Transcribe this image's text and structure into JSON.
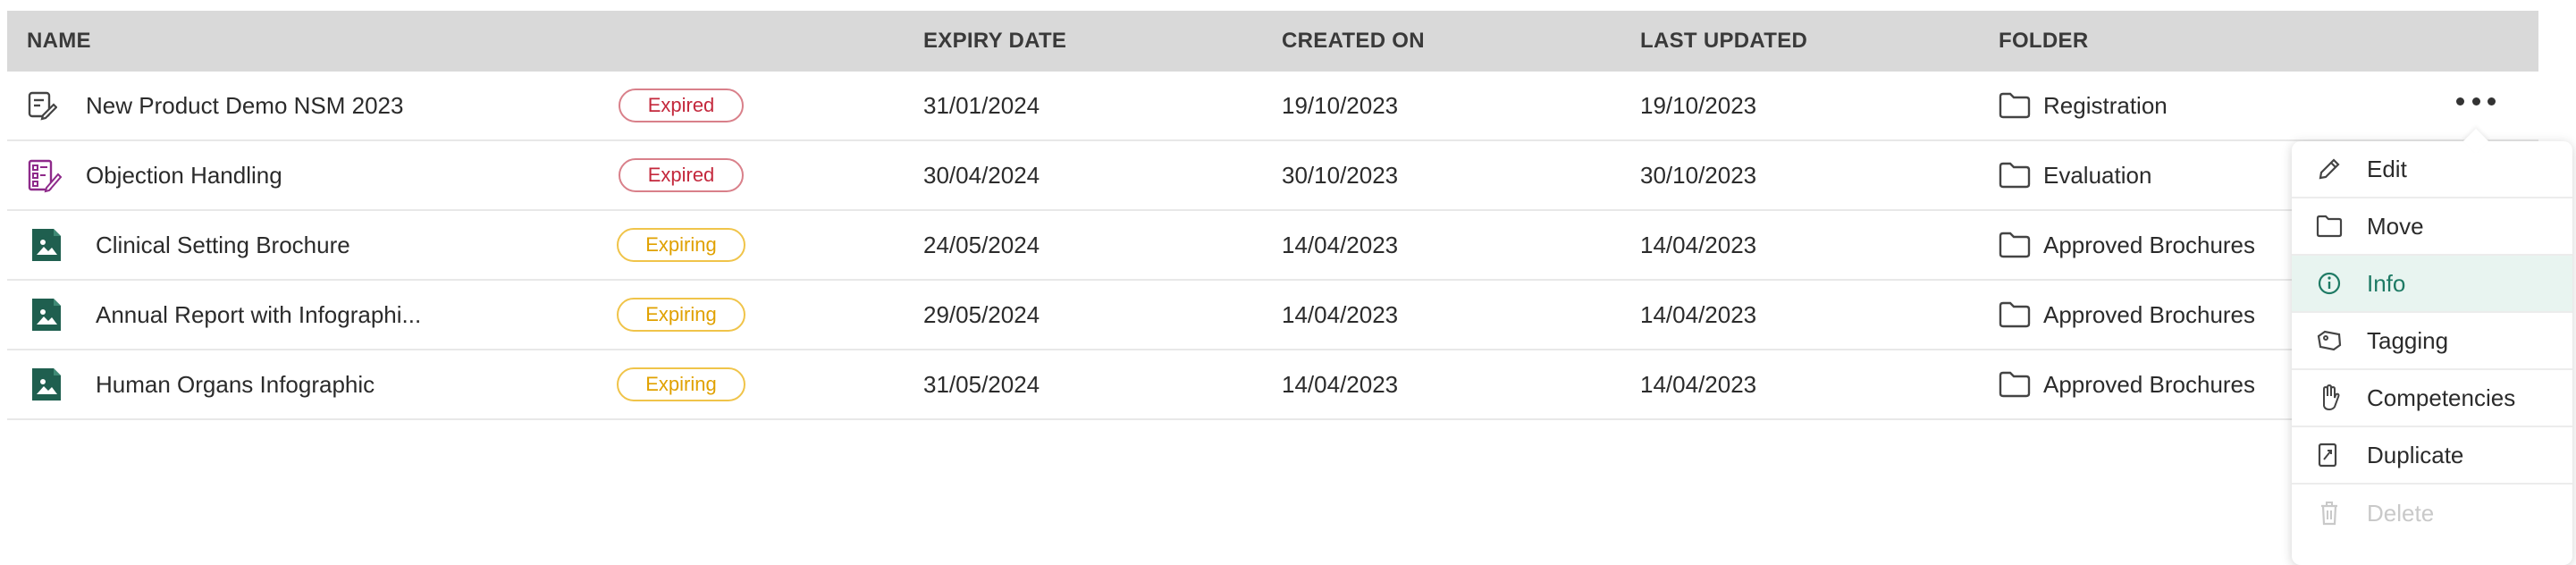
{
  "headers": {
    "name": "NAME",
    "expiry": "EXPIRY DATE",
    "created": "CREATED ON",
    "updated": "LAST UPDATED",
    "folder": "FOLDER"
  },
  "rows": [
    {
      "icon": "form-edit-icon",
      "name": "New Product Demo NSM 2023",
      "status": "Expired",
      "expiry": "31/01/2024",
      "created": "19/10/2023",
      "updated": "19/10/2023",
      "folder": "Registration"
    },
    {
      "icon": "checklist-edit-icon",
      "name": "Objection Handling",
      "status": "Expired",
      "expiry": "30/04/2024",
      "created": "30/10/2023",
      "updated": "30/10/2023",
      "folder": "Evaluation"
    },
    {
      "icon": "image-file-icon",
      "name": "Clinical Setting Brochure",
      "status": "Expiring",
      "expiry": "24/05/2024",
      "created": "14/04/2023",
      "updated": "14/04/2023",
      "folder": "Approved Brochures"
    },
    {
      "icon": "image-file-icon",
      "name": "Annual Report with Infographi...",
      "status": "Expiring",
      "expiry": "29/05/2024",
      "created": "14/04/2023",
      "updated": "14/04/2023",
      "folder": "Approved Brochures"
    },
    {
      "icon": "image-file-icon",
      "name": "Human Organs Infographic",
      "status": "Expiring",
      "expiry": "31/05/2024",
      "created": "14/04/2023",
      "updated": "14/04/2023",
      "folder": "Approved Brochures"
    }
  ],
  "menu": {
    "items": [
      {
        "label": "Edit",
        "icon": "pencil-icon",
        "state": "normal"
      },
      {
        "label": "Move",
        "icon": "folder-icon",
        "state": "normal"
      },
      {
        "label": "Info",
        "icon": "info-icon",
        "state": "active"
      },
      {
        "label": "Tagging",
        "icon": "tag-icon",
        "state": "normal"
      },
      {
        "label": "Competencies",
        "icon": "hand-icon",
        "state": "normal"
      },
      {
        "label": "Duplicate",
        "icon": "duplicate-icon",
        "state": "normal"
      },
      {
        "label": "Delete",
        "icon": "trash-icon",
        "state": "disabled"
      }
    ]
  },
  "colors": {
    "header_bg": "#d9d9d9",
    "expired": "#c4283c",
    "expiring": "#e0a100",
    "image_icon": "#1f5f4f",
    "checklist_icon": "#8e2a8a",
    "active_bg": "#e8f4f0",
    "active_text": "#1e7a64"
  }
}
